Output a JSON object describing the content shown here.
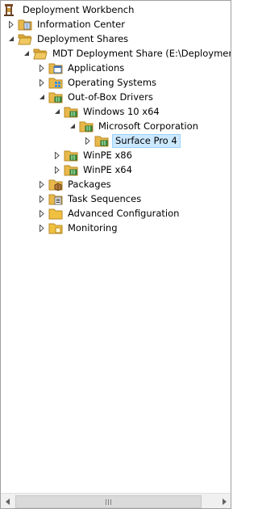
{
  "tree": {
    "root": {
      "label": "Deployment Workbench",
      "icon": "deployment-workbench-icon"
    },
    "info_center": {
      "label": "Information Center",
      "icon": "folder-icon"
    },
    "deployment_shares": {
      "label": "Deployment Shares",
      "icon": "open-folder-icon"
    },
    "mdt_share": {
      "label": "MDT Deployment Share (E:\\DeploymentSh",
      "icon": "open-folder-icon"
    },
    "applications": {
      "label": "Applications",
      "icon": "folder-icon"
    },
    "operating_systems": {
      "label": "Operating Systems",
      "icon": "folder-icon"
    },
    "drivers": {
      "label": "Out-of-Box Drivers",
      "icon": "open-folder-icon"
    },
    "win10": {
      "label": "Windows 10 x64",
      "icon": "open-folder-icon"
    },
    "microsoft": {
      "label": "Microsoft Corporation",
      "icon": "open-folder-icon"
    },
    "surface": {
      "label": "Surface Pro 4",
      "icon": "folder-icon",
      "selected": true
    },
    "winpe86": {
      "label": "WinPE x86",
      "icon": "folder-icon"
    },
    "winpe64": {
      "label": "WinPE x64",
      "icon": "folder-icon"
    },
    "packages": {
      "label": "Packages",
      "icon": "folder-icon"
    },
    "task_sequences": {
      "label": "Task Sequences",
      "icon": "folder-icon"
    },
    "advanced_config": {
      "label": "Advanced Configuration",
      "icon": "folder-icon"
    },
    "monitoring": {
      "label": "Monitoring",
      "icon": "folder-icon"
    }
  },
  "scrollbar": {
    "left_arrow": "◀",
    "right_arrow": "▶"
  },
  "colors": {
    "selection_bg": "#cce8ff",
    "selection_border": "#99d1ff",
    "folder": "#e8b84a"
  }
}
